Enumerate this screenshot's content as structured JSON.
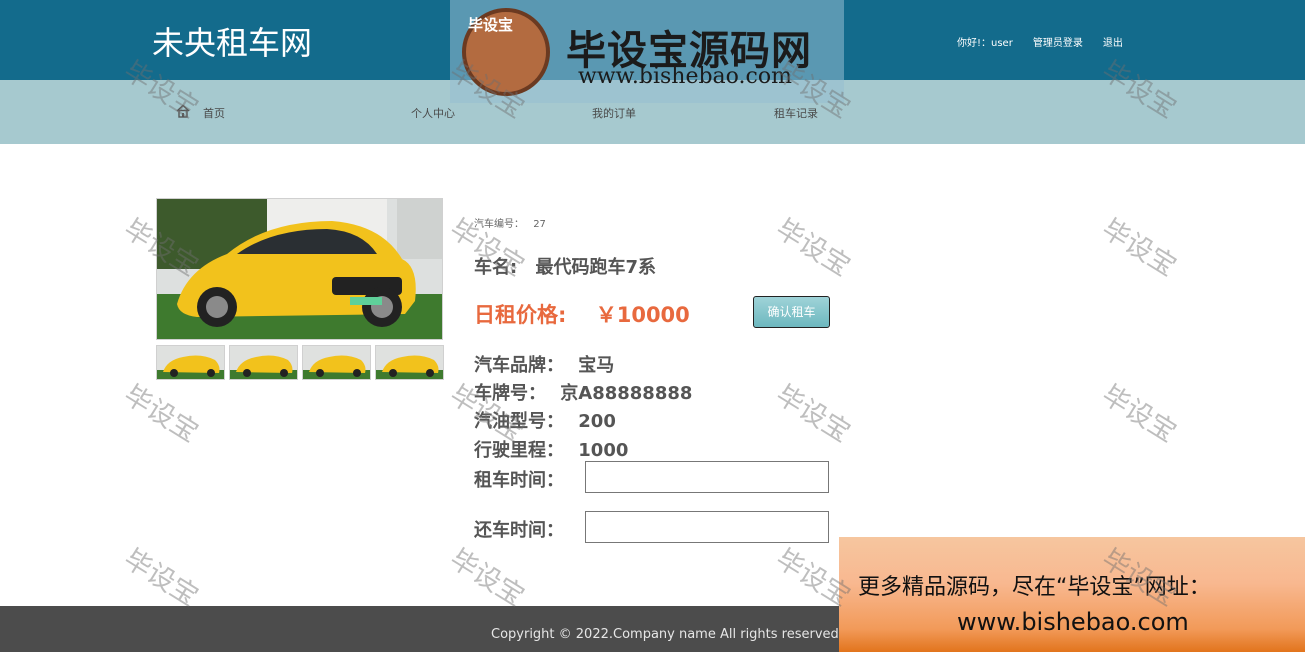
{
  "header": {
    "site_title": "未央租车网",
    "greeting": "你好!：user",
    "admin_login": "管理员登录",
    "logout": "退出"
  },
  "nav": {
    "home": "首页",
    "personal_center": "个人中心",
    "my_orders": "我的订单",
    "rental_records": "租车记录"
  },
  "car": {
    "id_label": "汽车编号：",
    "id_value": "27",
    "name_label": "车名:",
    "name_value": "最代码跑车7系",
    "price_label": "日租价格:",
    "price_value": "￥10000",
    "brand_label": "汽车品牌：",
    "brand_value": "宝马",
    "plate_label": "车牌号：",
    "plate_value": "京A88888888",
    "fuel_label": "汽油型号：",
    "fuel_value": "200",
    "mileage_label": "行驶里程：",
    "mileage_value": "1000",
    "rent_time_label": "租车时间：",
    "rent_time_value": "",
    "return_time_label": "还车时间：",
    "return_time_value": "",
    "confirm_button": "确认租车",
    "thumbnail_count": 4
  },
  "footer": {
    "copyright": "Copyright © 2022.Company name All rights reserved."
  },
  "promo": {
    "line1": "更多精品源码，尽在“毕设宝”网址：",
    "line2": "www.bishebao.com"
  },
  "watermark": {
    "badge": "毕设宝",
    "title": "毕设宝源码网",
    "url": "www.bishebao.com",
    "tile_text": "毕设宝"
  },
  "colors": {
    "header_bg": "#136b8c",
    "nav_bg": "#a6c9cf",
    "price": "#e8693e",
    "footer_bg": "#4c4c4c"
  }
}
